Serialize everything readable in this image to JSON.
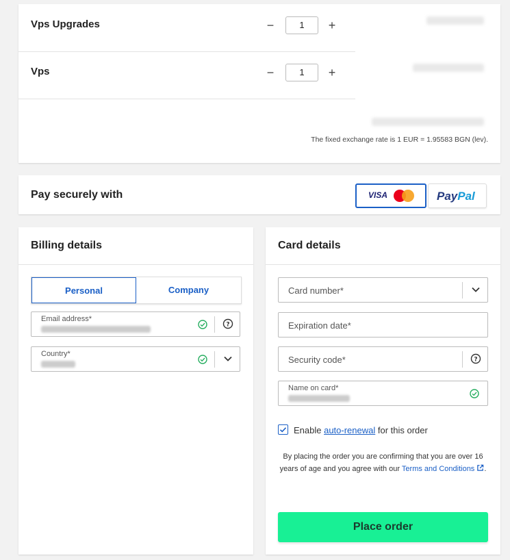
{
  "products": {
    "items": [
      {
        "name": "Vps Upgrades",
        "qty": "1",
        "minus": "−",
        "plus": "+"
      },
      {
        "name": "Vps",
        "qty": "1",
        "minus": "−",
        "plus": "+"
      }
    ],
    "exchange_rate": "The fixed exchange rate is 1 EUR = 1.95583 BGN (lev)."
  },
  "pay": {
    "title": "Pay securely with",
    "visa": "VISA",
    "paypal_part1": "Pay",
    "paypal_part2": "Pal"
  },
  "billing": {
    "title": "Billing details",
    "personal": "Personal",
    "company": "Company",
    "email_label": "Email address*",
    "country_label": "Country*"
  },
  "card": {
    "title": "Card details",
    "number_placeholder": "Card number*",
    "expiry_placeholder": "Expiration date*",
    "security_placeholder": "Security code*",
    "name_label": "Name on card*",
    "renew_prefix": "Enable ",
    "renew_link": "auto-renewal",
    "renew_suffix": " for this order",
    "legal_text": "By placing the order you are confirming that you are over 16 years of age and you agree with our ",
    "terms_link": "Terms and Conditions",
    "legal_end": ".",
    "place_order": "Place order"
  },
  "colors": {
    "accent": "#1a5fc6",
    "success": "#27ae60",
    "place_order": "#18f095"
  }
}
